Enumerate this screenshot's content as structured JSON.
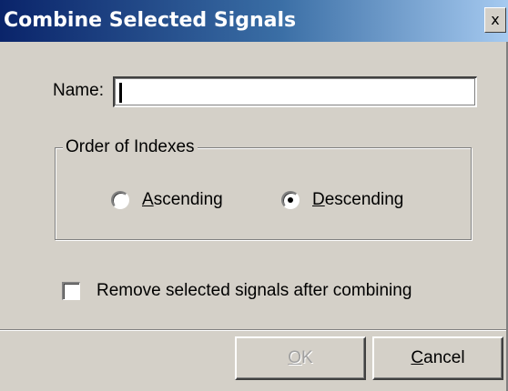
{
  "window": {
    "title": "Combine Selected Signals",
    "close_glyph": "x"
  },
  "form": {
    "name_label_prefix": "N",
    "name_label_rest": "ame:",
    "name_value": ""
  },
  "order_group": {
    "legend": "Order of Indexes",
    "ascending": {
      "label_accel": "A",
      "label_rest": "scending",
      "selected": false
    },
    "descending": {
      "label_accel": "D",
      "label_rest": "escending",
      "selected": true
    }
  },
  "remove_option": {
    "label": "Remove selected signals after combining",
    "checked": false
  },
  "buttons": {
    "ok_accel": "O",
    "ok_rest": "K",
    "ok_enabled": false,
    "cancel_accel": "C",
    "cancel_rest": "ancel"
  },
  "colors": {
    "titlebar_start": "#0a246a",
    "titlebar_end": "#a6caf0",
    "face": "#d4d0c8",
    "disabled_text": "#a0a0a0"
  }
}
